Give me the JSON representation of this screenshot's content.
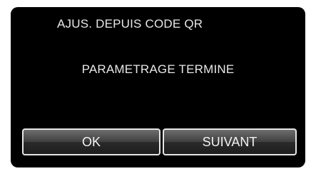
{
  "dialog": {
    "title": "AJUS. DEPUIS CODE QR",
    "message": "PARAMETRAGE TERMINE",
    "buttons": {
      "ok_label": "OK",
      "next_label": "SUIVANT"
    }
  }
}
